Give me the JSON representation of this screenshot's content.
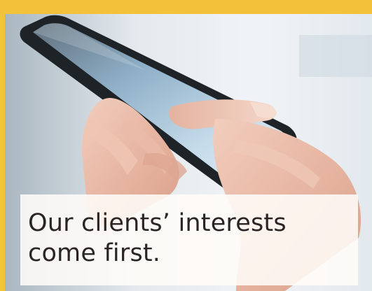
{
  "banner": {
    "headline": "Our clients’ interests\ncome first.",
    "image": "hands-holding-smartphone-photo"
  },
  "colors": {
    "frame": "#f3c23a",
    "caption_background": "#fffcf8",
    "caption_text": "#2a2524"
  }
}
